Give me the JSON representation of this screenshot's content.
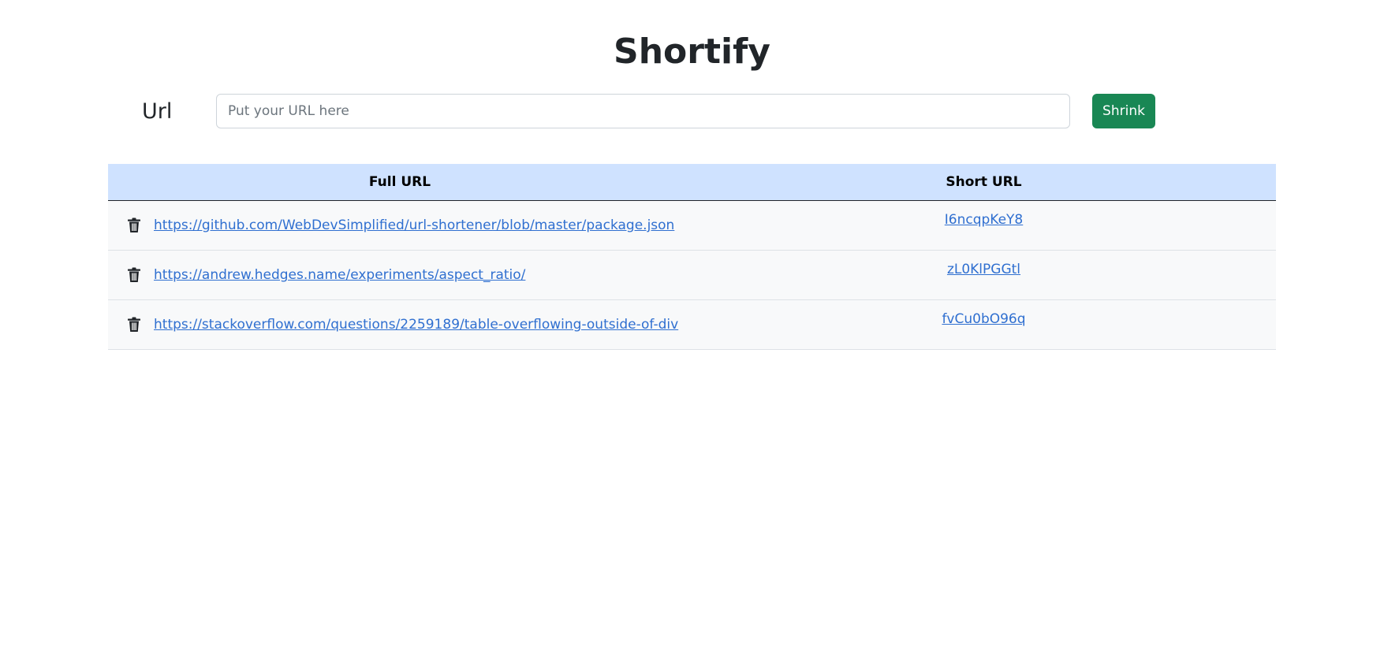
{
  "app": {
    "title": "Shortify"
  },
  "form": {
    "label": "Url",
    "input_placeholder": "Put your URL here",
    "input_value": "",
    "submit_label": "Shrink"
  },
  "table": {
    "headers": {
      "full": "Full URL",
      "short": "Short URL"
    },
    "rows": [
      {
        "full": "https://github.com/WebDevSimplified/url-shortener/blob/master/package.json",
        "short": "I6ncqpKeY8",
        "delete_icon": "trash-icon"
      },
      {
        "full": "https://andrew.hedges.name/experiments/aspect_ratio/",
        "short": "zL0KlPGGtl",
        "delete_icon": "trash-icon"
      },
      {
        "full": "https://stackoverflow.com/questions/2259189/table-overflowing-outside-of-div",
        "short": "fvCu0bO96q",
        "delete_icon": "trash-icon"
      }
    ]
  },
  "colors": {
    "primary_button": "#198754",
    "table_header": "#cfe2ff",
    "row_background": "#f8f9fa",
    "link": "#2f6fd0"
  }
}
